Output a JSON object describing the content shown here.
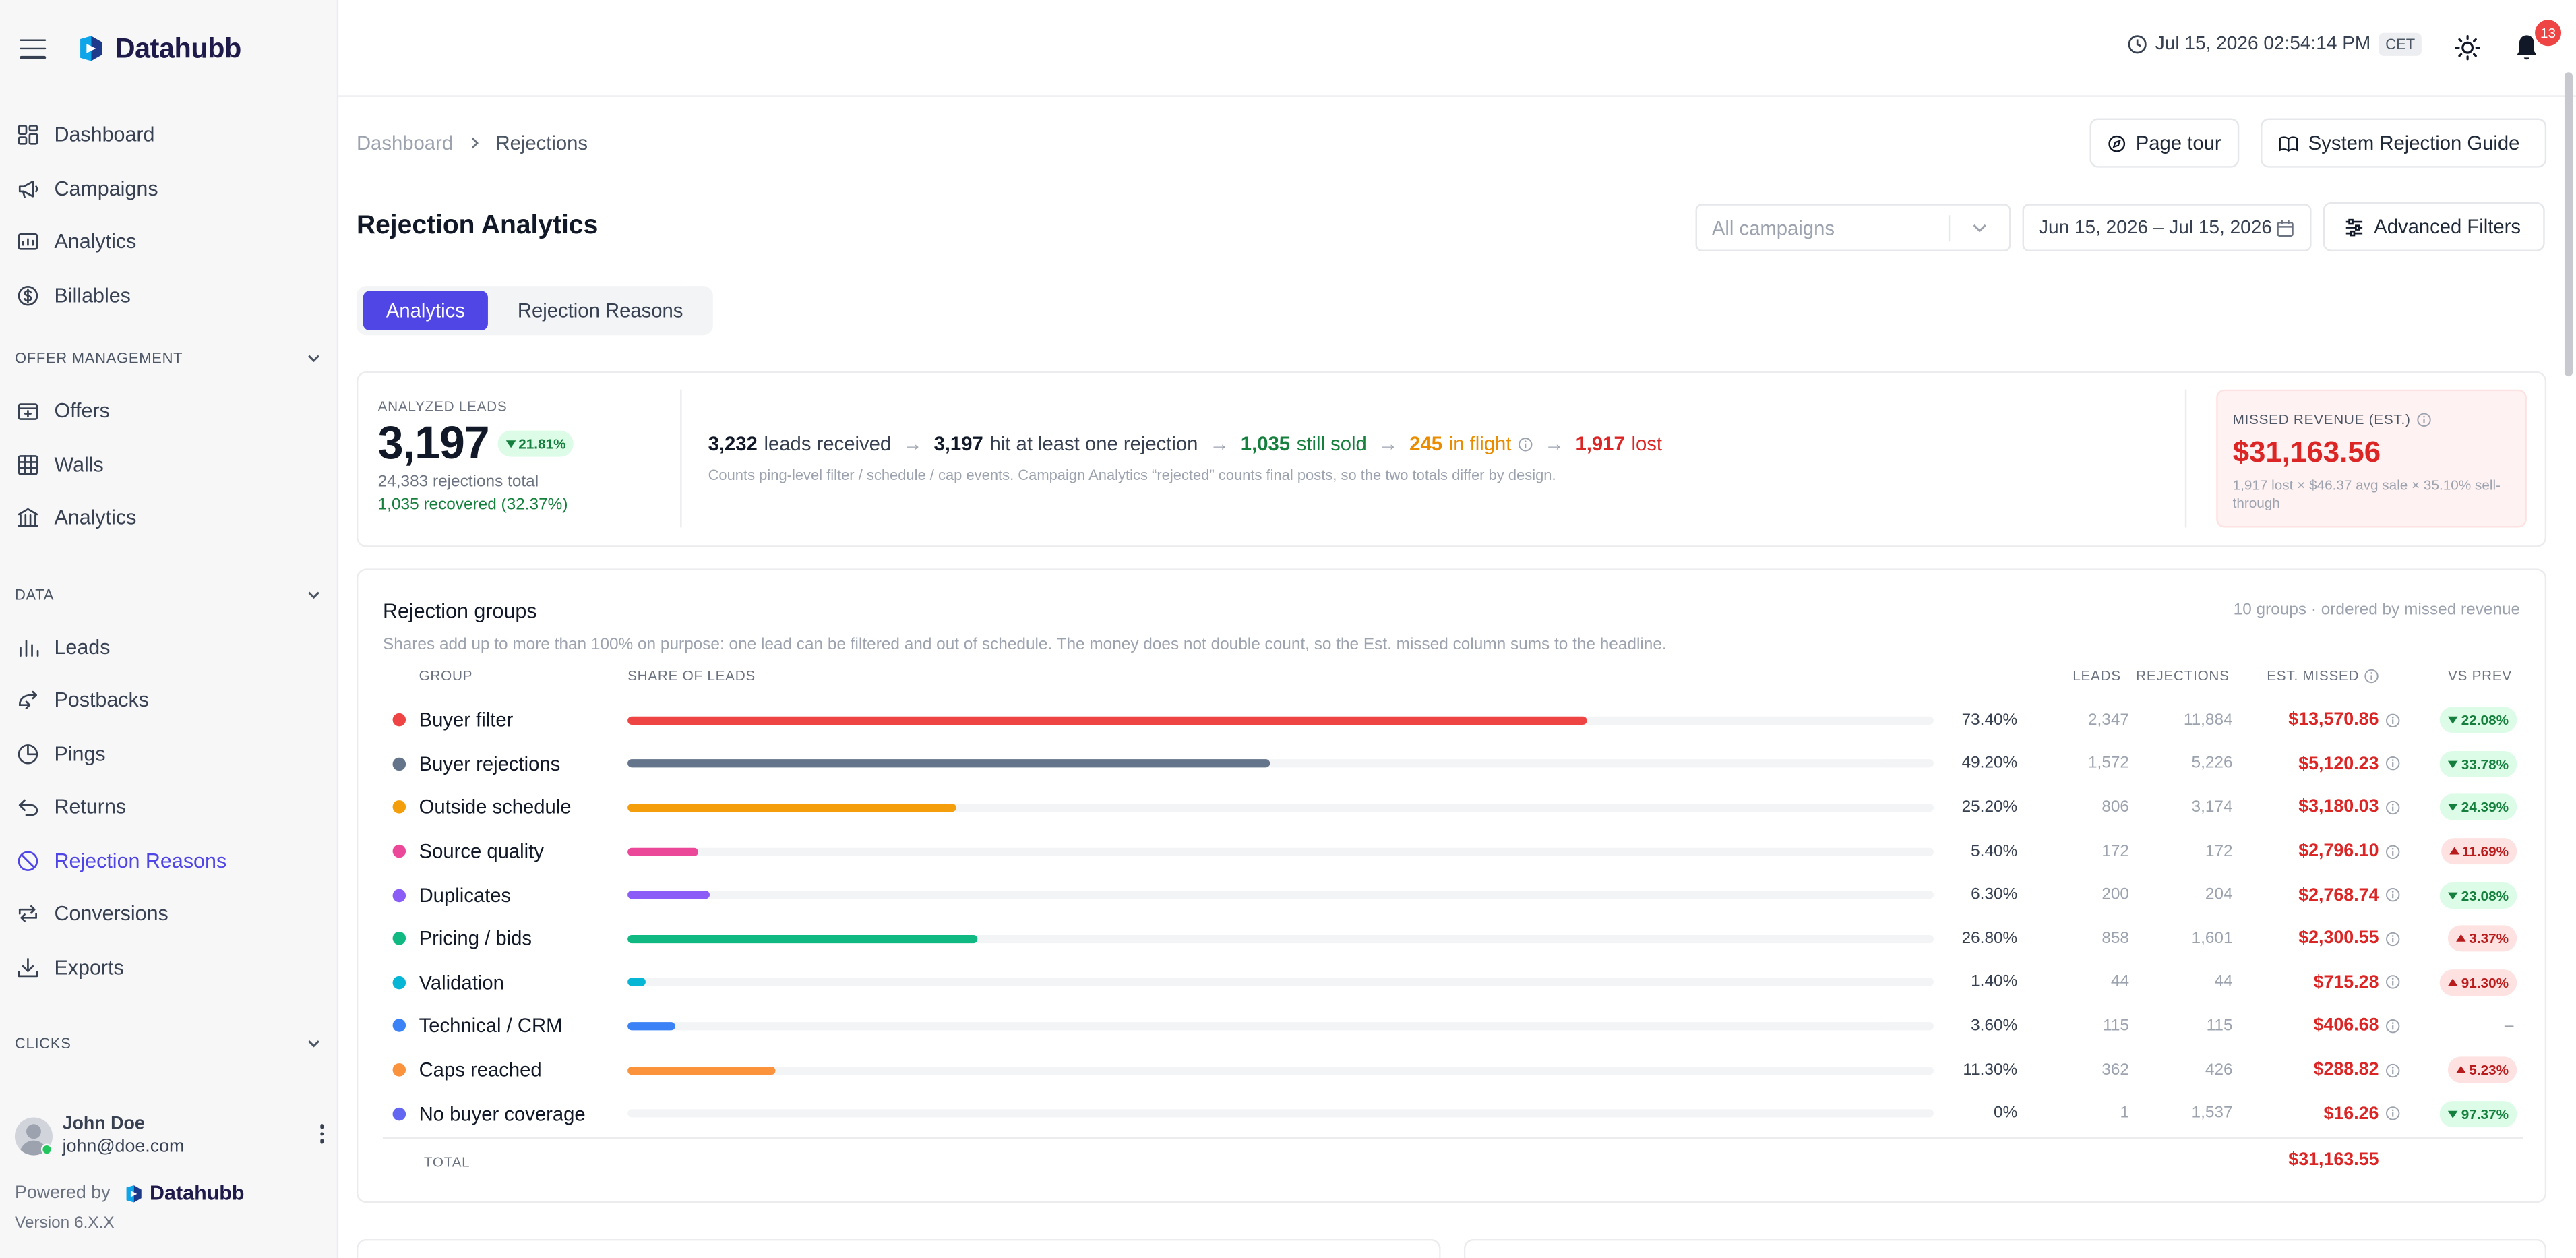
{
  "app": {
    "brand": "Datahubb"
  },
  "sidebar": {
    "main_items": [
      {
        "label": "Dashboard",
        "icon": "dashboard-icon"
      },
      {
        "label": "Campaigns",
        "icon": "megaphone-icon"
      },
      {
        "label": "Analytics",
        "icon": "analytics-icon"
      },
      {
        "label": "Billables",
        "icon": "dollar-icon"
      }
    ],
    "offer_section": "OFFER MANAGEMENT",
    "offer_items": [
      {
        "label": "Offers",
        "icon": "offers-icon"
      },
      {
        "label": "Walls",
        "icon": "walls-icon"
      },
      {
        "label": "Analytics",
        "icon": "bank-icon"
      }
    ],
    "data_section": "DATA",
    "data_items": [
      {
        "label": "Leads",
        "icon": "bar-chart-icon"
      },
      {
        "label": "Postbacks",
        "icon": "postbacks-icon"
      },
      {
        "label": "Pings",
        "icon": "pings-icon"
      },
      {
        "label": "Returns",
        "icon": "return-icon"
      },
      {
        "label": "Rejection Reasons",
        "icon": "ban-icon",
        "active": true
      },
      {
        "label": "Conversions",
        "icon": "conversions-icon"
      },
      {
        "label": "Exports",
        "icon": "download-icon"
      }
    ],
    "clicks_section": "CLICKS",
    "user": {
      "name": "John Doe",
      "email": "john@doe.com"
    },
    "powered_by": "Powered by",
    "version": "Version 6.X.X"
  },
  "topbar": {
    "datetime": "Jul 15, 2026 02:54:14 PM",
    "timezone": "CET",
    "notifications": "13"
  },
  "header": {
    "breadcrumb": [
      "Dashboard",
      "Rejections"
    ],
    "page_tour": "Page tour",
    "guide": "System Rejection Guide",
    "title": "Rejection Analytics",
    "campaign_placeholder": "All campaigns",
    "date_range": "Jun 15, 2026 – Jul 15, 2026",
    "advanced_filters": "Advanced Filters",
    "tabs": [
      "Analytics",
      "Rejection Reasons"
    ]
  },
  "summary": {
    "analyzed_label": "ANALYZED LEADS",
    "analyzed_value": "3,197",
    "analyzed_change": "21.81%",
    "rejections_total": "24,383 rejections total",
    "recovered": "1,035 recovered (32.37%)",
    "flow": {
      "received_num": "3,232",
      "received_txt": "leads received",
      "hit_num": "3,197",
      "hit_txt": "hit at least one rejection",
      "sold_num": "1,035",
      "sold_txt": "still sold",
      "flight_num": "245",
      "flight_txt": "in flight",
      "lost_num": "1,917",
      "lost_txt": "lost"
    },
    "note": "Counts ping-level filter / schedule / cap events. Campaign Analytics “rejected” counts final posts, so the two totals differ by design.",
    "missed_label": "MISSED REVENUE (EST.)",
    "missed_value": "$31,163.56",
    "missed_sub": "1,917 lost × $46.37 avg sale × 35.10% sell-through"
  },
  "groups": {
    "title": "Rejection groups",
    "meta": "10 groups · ordered by missed revenue",
    "desc": "Shares add up to more than 100% on purpose: one lead can be filtered and out of schedule. The money does not double count, so the Est. missed column sums to the headline.",
    "headers": {
      "group": "GROUP",
      "share": "SHARE OF LEADS",
      "leads": "LEADS",
      "rejections": "REJECTIONS",
      "missed": "EST. MISSED",
      "vs": "VS PREV"
    },
    "rows": [
      {
        "name": "Buyer filter",
        "color": "#ef4444",
        "share": 73.4,
        "share_txt": "73.40%",
        "leads": "2,347",
        "rejections": "11,884",
        "missed": "$13,570.86",
        "vs": "22.08%",
        "dir": "down"
      },
      {
        "name": "Buyer rejections",
        "color": "#64748b",
        "share": 49.2,
        "share_txt": "49.20%",
        "leads": "1,572",
        "rejections": "5,226",
        "missed": "$5,120.23",
        "vs": "33.78%",
        "dir": "down"
      },
      {
        "name": "Outside schedule",
        "color": "#f59e0b",
        "share": 25.2,
        "share_txt": "25.20%",
        "leads": "806",
        "rejections": "3,174",
        "missed": "$3,180.03",
        "vs": "24.39%",
        "dir": "down"
      },
      {
        "name": "Source quality",
        "color": "#ec4899",
        "share": 5.4,
        "share_txt": "5.40%",
        "leads": "172",
        "rejections": "172",
        "missed": "$2,796.10",
        "vs": "11.69%",
        "dir": "up"
      },
      {
        "name": "Duplicates",
        "color": "#8b5cf6",
        "share": 6.3,
        "share_txt": "6.30%",
        "leads": "200",
        "rejections": "204",
        "missed": "$2,768.74",
        "vs": "23.08%",
        "dir": "down"
      },
      {
        "name": "Pricing / bids",
        "color": "#10b981",
        "share": 26.8,
        "share_txt": "26.80%",
        "leads": "858",
        "rejections": "1,601",
        "missed": "$2,300.55",
        "vs": "3.37%",
        "dir": "up"
      },
      {
        "name": "Validation",
        "color": "#06b6d4",
        "share": 1.4,
        "share_txt": "1.40%",
        "leads": "44",
        "rejections": "44",
        "missed": "$715.28",
        "vs": "91.30%",
        "dir": "up"
      },
      {
        "name": "Technical / CRM",
        "color": "#3b82f6",
        "share": 3.6,
        "share_txt": "3.60%",
        "leads": "115",
        "rejections": "115",
        "missed": "$406.68",
        "vs": "–",
        "dir": "none"
      },
      {
        "name": "Caps reached",
        "color": "#fb923c",
        "share": 11.3,
        "share_txt": "11.30%",
        "leads": "362",
        "rejections": "426",
        "missed": "$288.82",
        "vs": "5.23%",
        "dir": "up"
      },
      {
        "name": "No buyer coverage",
        "color": "#6366f1",
        "share": 0,
        "share_txt": "0%",
        "leads": "1",
        "rejections": "1,537",
        "missed": "$16.26",
        "vs": "97.37%",
        "dir": "down"
      }
    ],
    "total_label": "TOTAL",
    "total_value": "$31,163.55"
  }
}
